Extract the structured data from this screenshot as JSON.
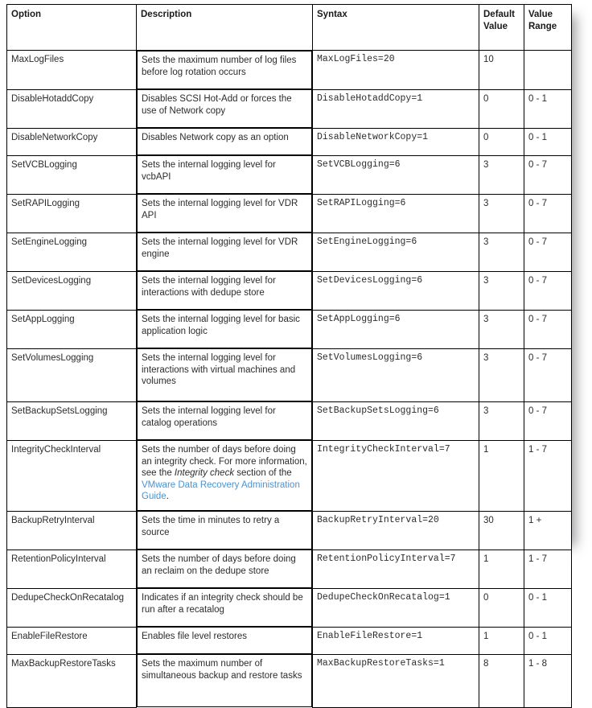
{
  "table": {
    "name": "vdr-configuration-options-table",
    "columns": [
      {
        "key": "option",
        "label": "Option"
      },
      {
        "key": "description",
        "label": "Description"
      },
      {
        "key": "syntax",
        "label": "Syntax"
      },
      {
        "key": "default",
        "label": "Default Value"
      },
      {
        "key": "range",
        "label": "Value Range"
      }
    ],
    "header_default_line1": "Default",
    "header_default_line2": "Value",
    "header_range_line1": "Value",
    "header_range_line2": "Range",
    "rows": [
      {
        "option": "MaxLogFiles",
        "description": "Sets the maximum number of log files before log rotation occurs",
        "syntax": "MaxLogFiles=20",
        "default": "10",
        "range": ""
      },
      {
        "option": "DisableHotaddCopy",
        "description": "Disables SCSI Hot-Add or forces the use of Network copy",
        "syntax": "DisableHotaddCopy=1",
        "default": "0",
        "range": "0 - 1"
      },
      {
        "option": "DisableNetworkCopy",
        "description": "Disables Network copy as an option",
        "syntax": "DisableNetworkCopy=1",
        "default": "0",
        "range": "0 - 1"
      },
      {
        "option": "SetVCBLogging",
        "description": "Sets the internal logging level for vcbAPI",
        "syntax": "SetVCBLogging=6",
        "default": "3",
        "range": "0 - 7"
      },
      {
        "option": "SetRAPILogging",
        "description": "Sets the internal logging level for VDR API",
        "syntax": "SetRAPILogging=6",
        "default": "3",
        "range": "0 - 7"
      },
      {
        "option": "SetEngineLogging",
        "description": "Sets the internal logging level for VDR engine",
        "syntax": "SetEngineLogging=6",
        "default": "3",
        "range": "0 - 7"
      },
      {
        "option": "SetDevicesLogging",
        "description": "Sets the internal logging level for interactions with dedupe store",
        "syntax": "SetDevicesLogging=6",
        "default": "3",
        "range": "0 - 7"
      },
      {
        "option": "SetAppLogging",
        "description": "Sets the internal logging level for basic application logic",
        "syntax": "SetAppLogging=6",
        "default": "3",
        "range": "0 - 7"
      },
      {
        "option": "SetVolumesLogging",
        "description": "Sets the internal logging level for interactions with virtual machines and volumes",
        "syntax": "SetVolumesLogging=6",
        "default": "3",
        "range": "0 - 7"
      },
      {
        "option": "SetBackupSetsLogging",
        "description": "Sets the internal logging level for catalog operations",
        "syntax": "SetBackupSetsLogging=6",
        "default": "3",
        "range": "0 - 7"
      },
      {
        "option": "IntegrityCheckInterval",
        "description_parts": {
          "lead": "Sets the number of days before doing an integrity check. For more information, see the ",
          "italic": "Integrity check",
          "mid": " section of the ",
          "link": "VMware Data Recovery Administration Guide",
          "tail": "."
        },
        "syntax": "IntegrityCheckInterval=7",
        "default": "1",
        "range": "1 - 7"
      },
      {
        "option": "BackupRetryInterval",
        "description": "Sets the time in minutes to retry a source",
        "syntax": "BackupRetryInterval=20",
        "default": "30",
        "range": "1 +"
      },
      {
        "option": "RetentionPolicyInterval",
        "description": "Sets the number of days before doing an reclaim on the dedupe store",
        "syntax": "RetentionPolicyInterval=7",
        "default": "1",
        "range": "1 - 7"
      },
      {
        "option": "DedupeCheckOnRecatalog",
        "description": "Indicates if an integrity check should be run after a recatalog",
        "syntax": "DedupeCheckOnRecatalog=1",
        "default": "0",
        "range": "0 - 1"
      },
      {
        "option": "EnableFileRestore",
        "description": "Enables file level restores",
        "syntax": "EnableFileRestore=1",
        "default": "1",
        "range": "0 - 1"
      },
      {
        "option": "MaxBackupRestoreTasks",
        "description": "Sets the maximum number of simultaneous backup and restore tasks",
        "syntax": "MaxBackupRestoreTasks=1",
        "default": "8",
        "range": "1 - 8"
      }
    ]
  },
  "colors": {
    "text": "#2c2c2c",
    "header_text": "#1a1a1a",
    "border": "#000000",
    "link": "#4a93d1",
    "background": "#ffffff"
  }
}
